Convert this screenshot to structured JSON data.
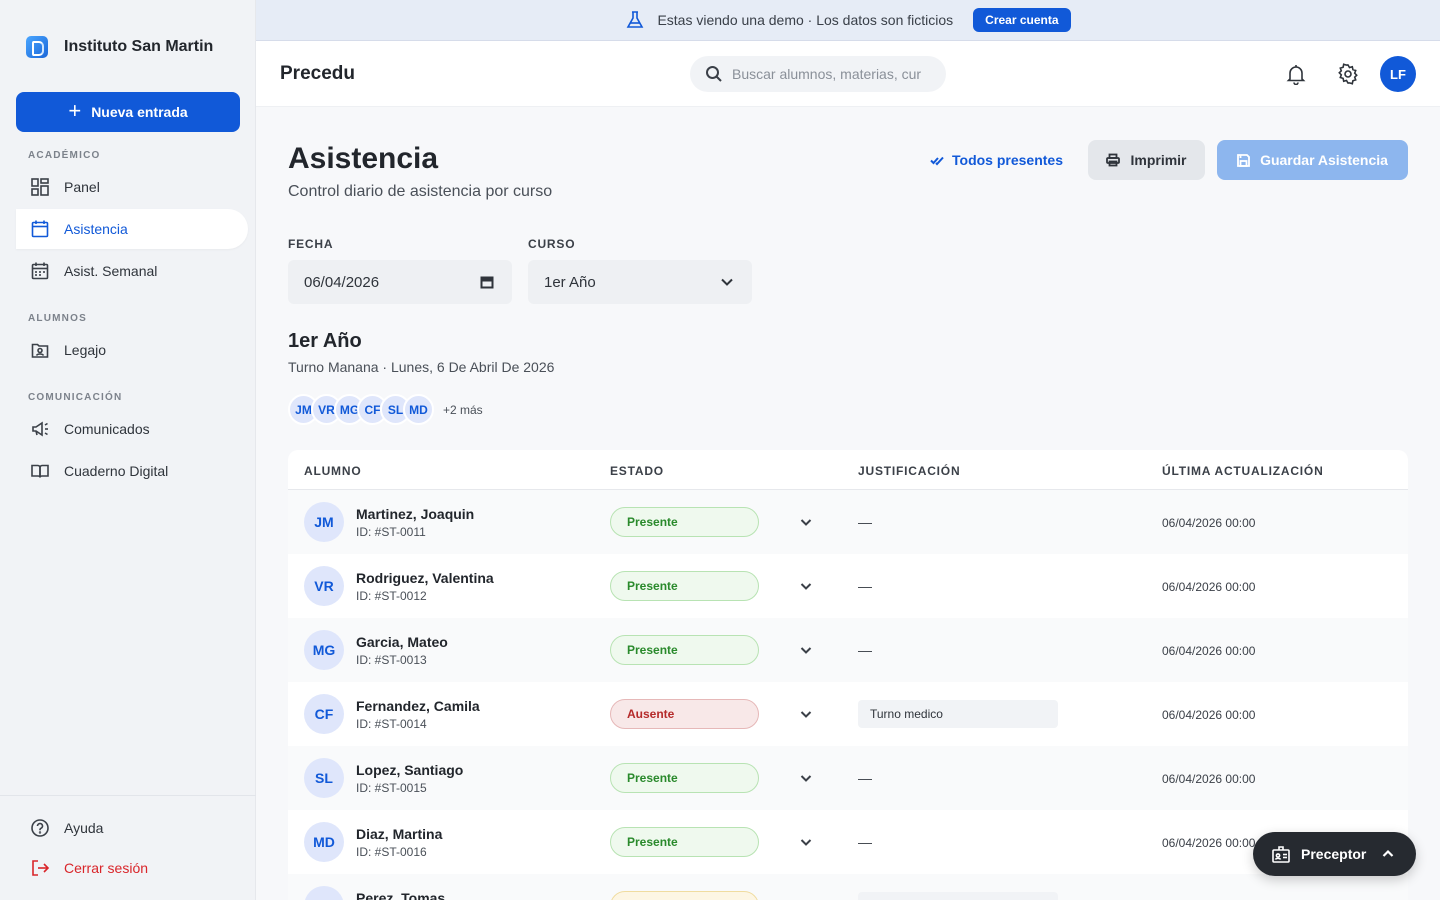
{
  "sidebar": {
    "brand": "Instituto San Martin",
    "new_button": "Nueva entrada",
    "sections": {
      "academico": "ACADÉMICO",
      "alumnos": "ALUMNOS",
      "comunicacion": "COMUNICACIÓN"
    },
    "items": {
      "panel": "Panel",
      "asistencia": "Asistencia",
      "asist_semanal": "Asist. Semanal",
      "legajo": "Legajo",
      "comunicados": "Comunicados",
      "cuaderno": "Cuaderno Digital"
    },
    "bottom": {
      "ayuda": "Ayuda",
      "logout": "Cerrar sesión"
    }
  },
  "banner": {
    "text": "Estas viendo una demo · Los datos son ficticios",
    "button": "Crear cuenta"
  },
  "topbar": {
    "title": "Precedu",
    "search_placeholder": "Buscar alumnos, materias, cur",
    "user_initials": "LF"
  },
  "page": {
    "title": "Asistencia",
    "subtitle": "Control diario de asistencia por curso",
    "actions": {
      "all_present": "Todos presentes",
      "print": "Imprimir",
      "save": "Guardar Asistencia"
    },
    "filters": {
      "fecha_label": "FECHA",
      "fecha_value": "06/04/2026",
      "curso_label": "CURSO",
      "curso_value": "1er Año"
    },
    "group": {
      "title": "1er Año",
      "subtitle": "Turno Manana · Lunes, 6 De Abril De 2026",
      "chips": [
        "JM",
        "VR",
        "MG",
        "CF",
        "SL",
        "MD"
      ],
      "more": "+2 más"
    }
  },
  "table": {
    "headers": {
      "alumno": "ALUMNO",
      "estado": "ESTADO",
      "justificacion": "JUSTIFICACIÓN",
      "actualizacion": "ÚLTIMA ACTUALIZACIÓN"
    },
    "rows": [
      {
        "initials": "JM",
        "name": "Martinez, Joaquin",
        "id": "ID: #ST-0011",
        "status": "Presente",
        "justification": "—",
        "updated": "06/04/2026 00:00"
      },
      {
        "initials": "VR",
        "name": "Rodriguez, Valentina",
        "id": "ID: #ST-0012",
        "status": "Presente",
        "justification": "—",
        "updated": "06/04/2026 00:00"
      },
      {
        "initials": "MG",
        "name": "Garcia, Mateo",
        "id": "ID: #ST-0013",
        "status": "Presente",
        "justification": "—",
        "updated": "06/04/2026 00:00"
      },
      {
        "initials": "CF",
        "name": "Fernandez, Camila",
        "id": "ID: #ST-0014",
        "status": "Ausente",
        "justification": "Turno medico",
        "updated": "06/04/2026 00:00"
      },
      {
        "initials": "SL",
        "name": "Lopez, Santiago",
        "id": "ID: #ST-0015",
        "status": "Presente",
        "justification": "—",
        "updated": "06/04/2026 00:00"
      },
      {
        "initials": "MD",
        "name": "Diaz, Martina",
        "id": "ID: #ST-0016",
        "status": "Presente",
        "justification": "—",
        "updated": "06/04/2026 00:00"
      },
      {
        "initials": "PT",
        "name": "Perez, Tomas",
        "id": "",
        "status": "",
        "justification": "",
        "updated": ""
      }
    ]
  },
  "role_pill": {
    "label": "Preceptor"
  },
  "colors": {
    "primary": "#1159d8",
    "present": "#2a8a2c",
    "absent": "#b52a2a",
    "danger": "#d9252a"
  }
}
